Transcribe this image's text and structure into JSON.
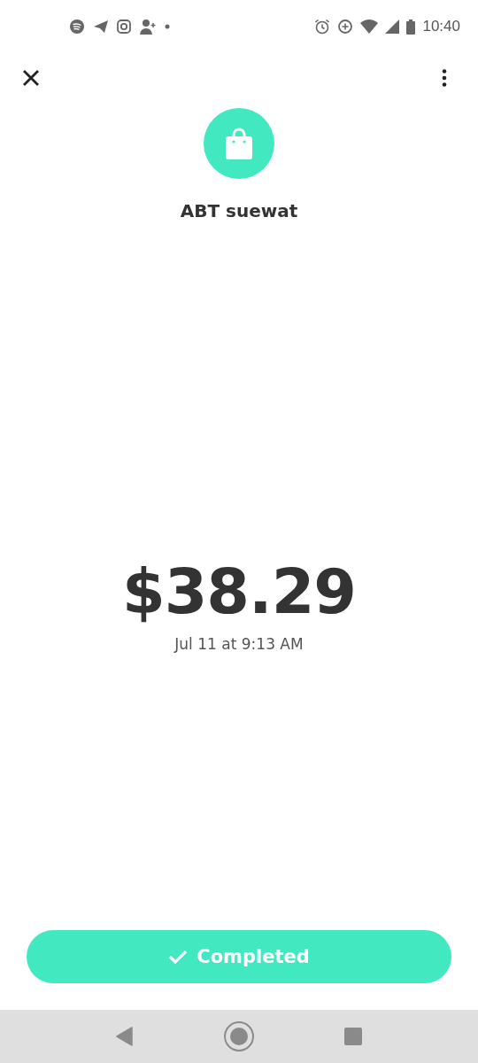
{
  "status_bar": {
    "time": "10:40"
  },
  "merchant": {
    "name": "ABT suewat"
  },
  "payment": {
    "amount": "$38.29",
    "date": "Jul 11 at 9:13 AM"
  },
  "status_button": {
    "label": "Completed"
  }
}
